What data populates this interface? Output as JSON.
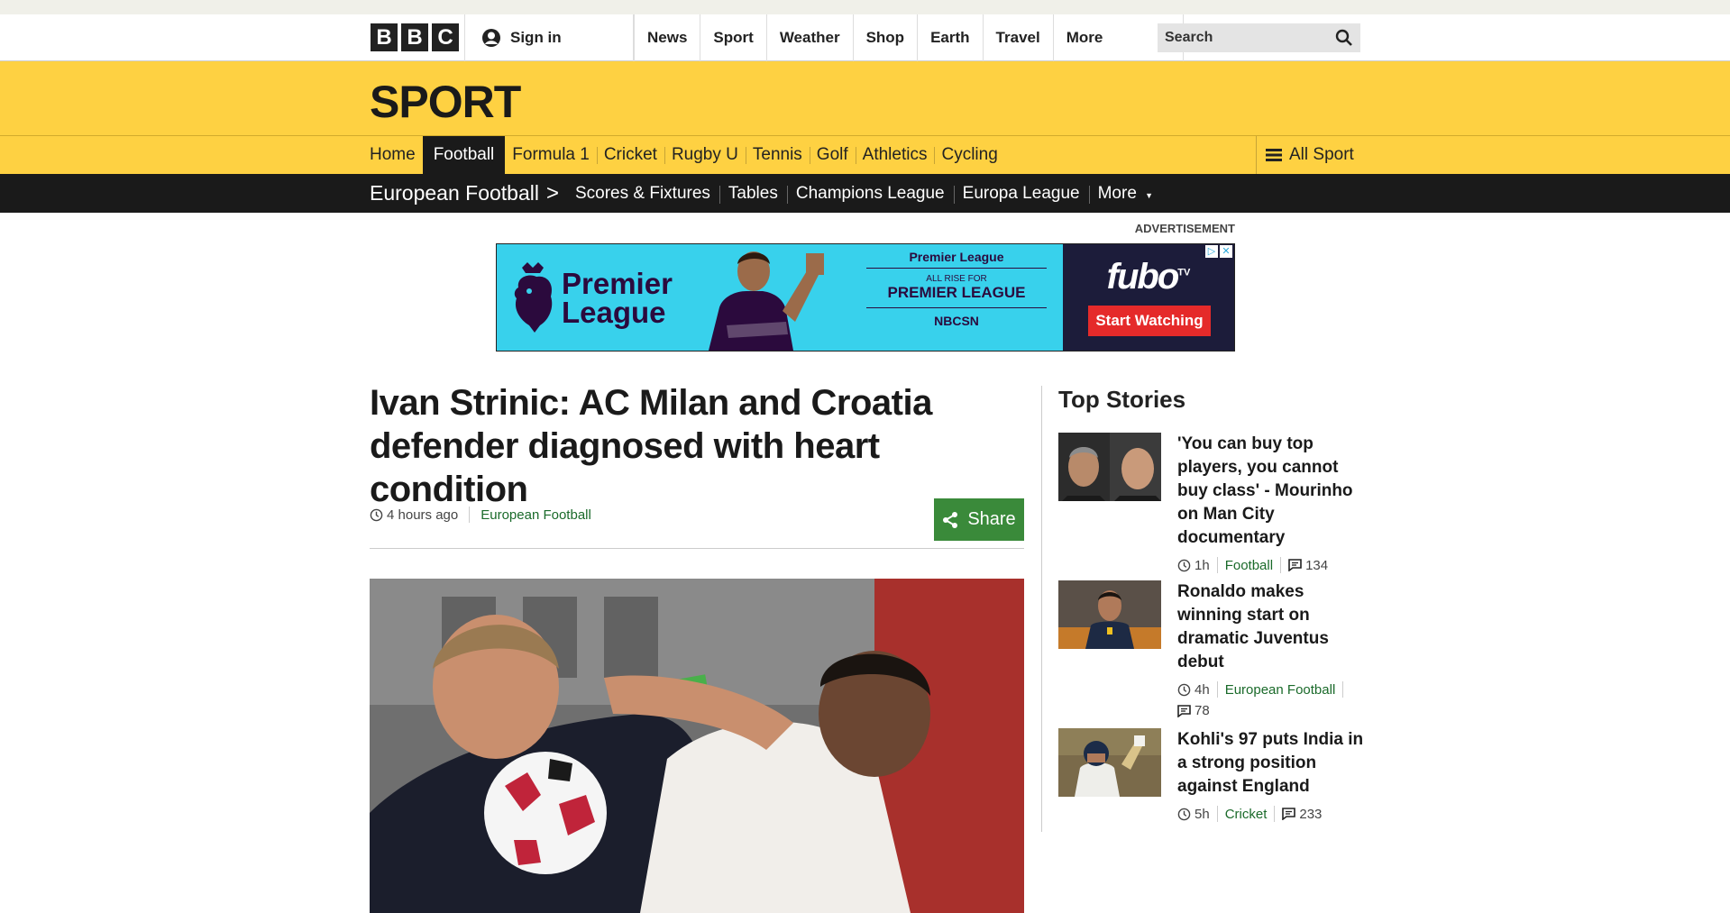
{
  "global": {
    "logo_letters": [
      "B",
      "B",
      "C"
    ],
    "signin_label": "Sign in",
    "nav_items": [
      "News",
      "Sport",
      "Weather",
      "Shop",
      "Earth",
      "Travel"
    ],
    "nav_more": "More",
    "search_placeholder": "Search"
  },
  "sport": {
    "title": "SPORT",
    "nav": [
      "Home",
      "Football",
      "Formula 1",
      "Cricket",
      "Rugby U",
      "Tennis",
      "Golf",
      "Athletics",
      "Cycling"
    ],
    "active": "Football",
    "all_sport": "All Sport"
  },
  "subnav": {
    "title": "European Football",
    "items": [
      "Scores & Fixtures",
      "Tables",
      "Champions League",
      "Europa League",
      "More"
    ]
  },
  "ad": {
    "label": "ADVERTISEMENT",
    "pl_line1": "Premier",
    "pl_line2": "League",
    "mid_brand": "Premier League",
    "mid_small": "ALL RISE FOR",
    "mid_big": "PREMIER LEAGUE",
    "mid_network": "NBCSN",
    "fubo": "fubo",
    "fubo_sup": "TV",
    "cta": "Start Watching"
  },
  "article": {
    "headline": "Ivan Strinic: AC Milan and Croatia defender diagnosed with heart condition",
    "time": "4 hours ago",
    "section": "European Football",
    "share_label": "Share"
  },
  "top_stories": {
    "title": "Top Stories",
    "stories": [
      {
        "headline": "'You can buy top players, you cannot buy class' - Mourinho on Man City documentary",
        "time": "1h",
        "section": "Football",
        "comments": "134"
      },
      {
        "headline": "Ronaldo makes winning start on dramatic Juventus debut",
        "time": "4h",
        "section": "European Football",
        "comments": "78"
      },
      {
        "headline": "Kohli's 97 puts India in a strong position against England",
        "time": "5h",
        "section": "Cricket",
        "comments": "233"
      }
    ]
  },
  "colors": {
    "sport_yellow": "#fed142",
    "bar_black": "#1a1a1a",
    "share_green": "#3a8a3a",
    "link_green": "#1a6a2a",
    "ad_cyan": "#38d1ec",
    "ad_red": "#e52a2a"
  }
}
